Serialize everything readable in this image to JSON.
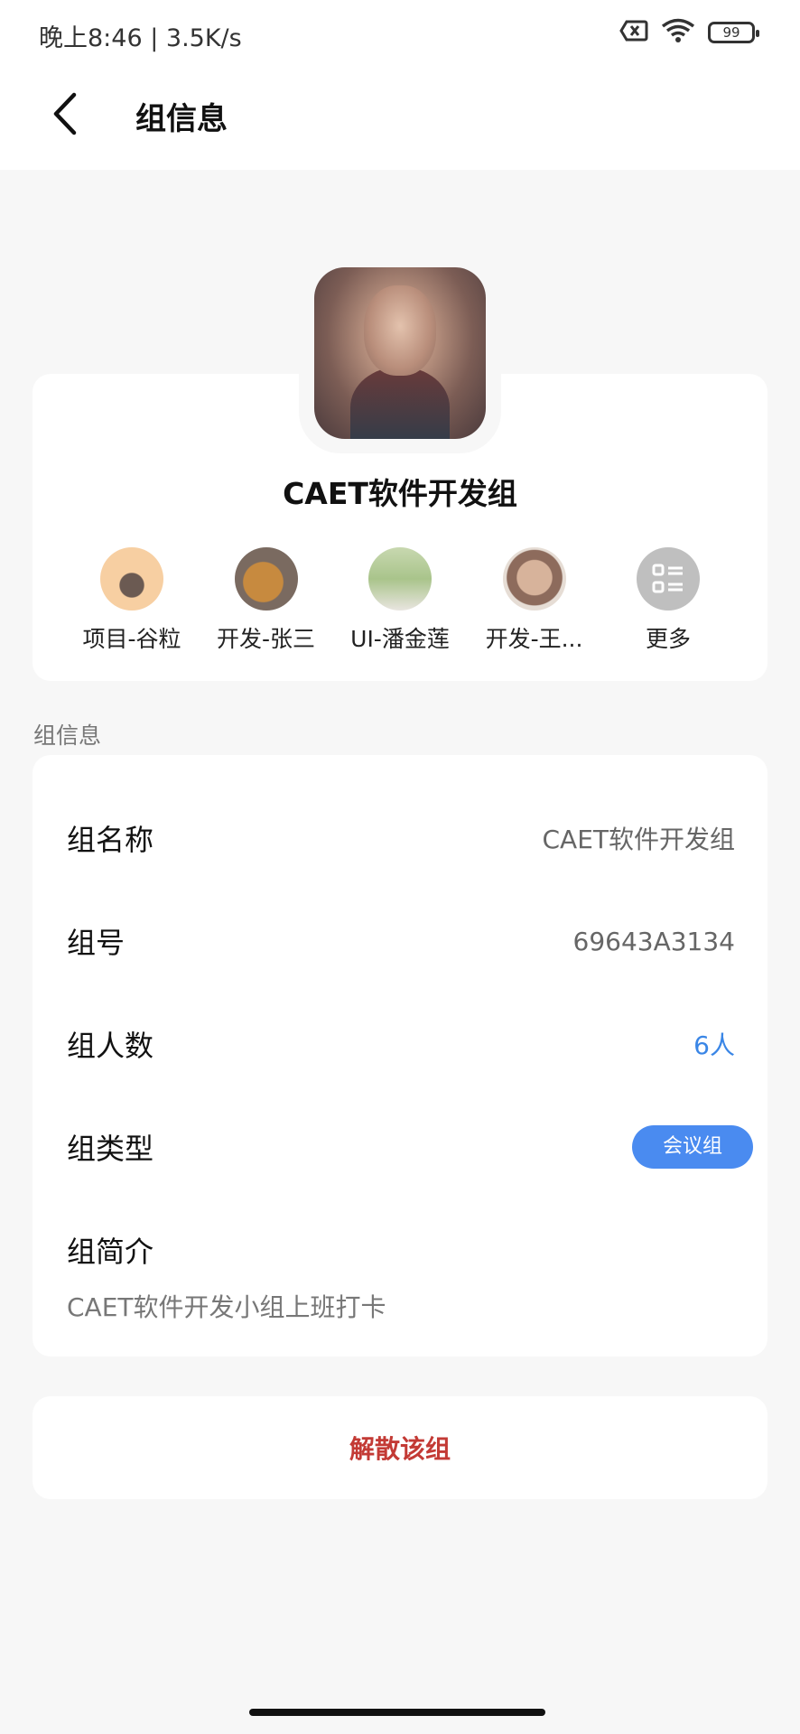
{
  "status_bar": {
    "time": "晚上8:46 | 3.5K/s",
    "battery": "99"
  },
  "header": {
    "title": "组信息"
  },
  "group": {
    "name": "CAET软件开发组",
    "members": [
      {
        "name": "项目-谷粒"
      },
      {
        "name": "开发-张三"
      },
      {
        "name": "UI-潘金莲"
      },
      {
        "name": "开发-王..."
      },
      {
        "name": "更多"
      }
    ]
  },
  "info_section": {
    "label": "组信息",
    "rows": [
      {
        "label": "组名称",
        "value": "CAET软件开发组"
      },
      {
        "label": "组号",
        "value": "69643A3134"
      },
      {
        "label": "组人数",
        "value": "6人"
      },
      {
        "label": "组类型",
        "value": "会议组"
      },
      {
        "label": "组简介",
        "value": "CAET软件开发小组上班打卡"
      }
    ]
  },
  "actions": {
    "dissolve_label": "解散该组"
  },
  "colors": {
    "accent_blue": "#4a8bf0",
    "danger_red": "#c33a35",
    "background": "#f7f7f7"
  },
  "icons": {
    "back": "chevron-left-icon",
    "more": "grid-list-icon"
  }
}
